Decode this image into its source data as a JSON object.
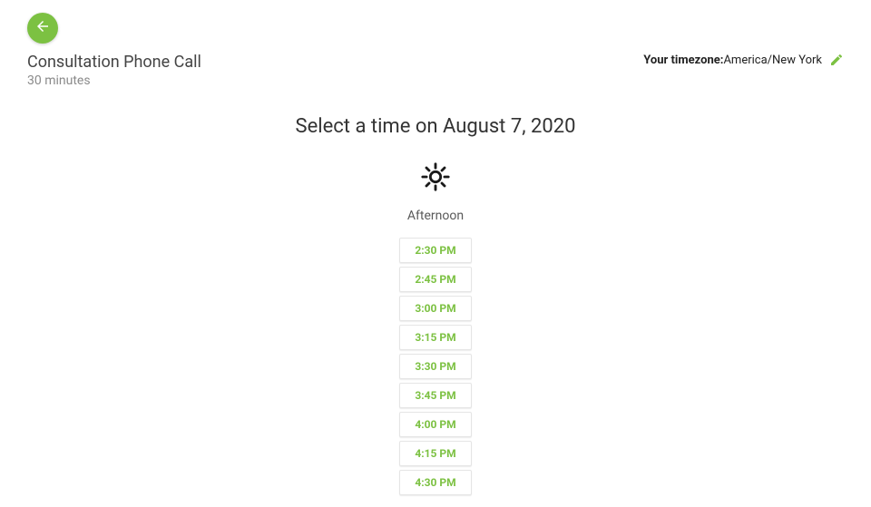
{
  "header": {
    "title": "Consultation Phone Call",
    "duration": "30 minutes",
    "timezone_label": "Your timezone:",
    "timezone_value": "America/New York"
  },
  "main": {
    "heading": "Select a time on August 7, 2020",
    "period_label": "Afternoon",
    "slots": [
      "2:30 PM",
      "2:45 PM",
      "3:00 PM",
      "3:15 PM",
      "3:30 PM",
      "3:45 PM",
      "4:00 PM",
      "4:15 PM",
      "4:30 PM"
    ]
  },
  "colors": {
    "accent": "#7cc142"
  }
}
